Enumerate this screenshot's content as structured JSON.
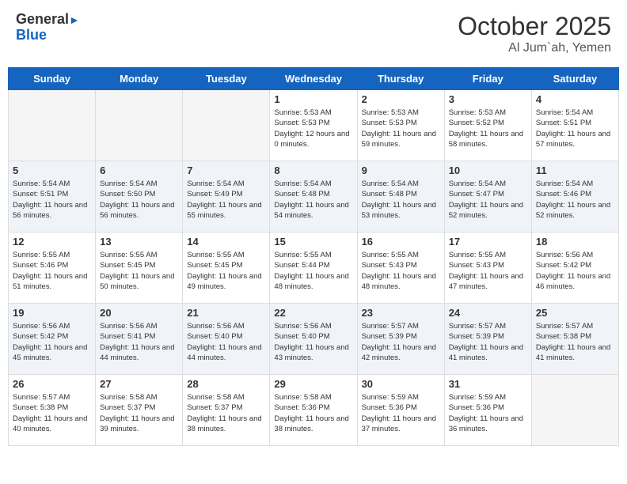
{
  "logo": {
    "line1": "General",
    "line2": "Blue"
  },
  "header": {
    "month": "October 2025",
    "location": "Al Jum`ah, Yemen"
  },
  "weekdays": [
    "Sunday",
    "Monday",
    "Tuesday",
    "Wednesday",
    "Thursday",
    "Friday",
    "Saturday"
  ],
  "weeks": [
    [
      {
        "day": "",
        "sunrise": "",
        "sunset": "",
        "daylight": ""
      },
      {
        "day": "",
        "sunrise": "",
        "sunset": "",
        "daylight": ""
      },
      {
        "day": "",
        "sunrise": "",
        "sunset": "",
        "daylight": ""
      },
      {
        "day": "1",
        "sunrise": "Sunrise: 5:53 AM",
        "sunset": "Sunset: 5:53 PM",
        "daylight": "Daylight: 12 hours and 0 minutes."
      },
      {
        "day": "2",
        "sunrise": "Sunrise: 5:53 AM",
        "sunset": "Sunset: 5:53 PM",
        "daylight": "Daylight: 11 hours and 59 minutes."
      },
      {
        "day": "3",
        "sunrise": "Sunrise: 5:53 AM",
        "sunset": "Sunset: 5:52 PM",
        "daylight": "Daylight: 11 hours and 58 minutes."
      },
      {
        "day": "4",
        "sunrise": "Sunrise: 5:54 AM",
        "sunset": "Sunset: 5:51 PM",
        "daylight": "Daylight: 11 hours and 57 minutes."
      }
    ],
    [
      {
        "day": "5",
        "sunrise": "Sunrise: 5:54 AM",
        "sunset": "Sunset: 5:51 PM",
        "daylight": "Daylight: 11 hours and 56 minutes."
      },
      {
        "day": "6",
        "sunrise": "Sunrise: 5:54 AM",
        "sunset": "Sunset: 5:50 PM",
        "daylight": "Daylight: 11 hours and 56 minutes."
      },
      {
        "day": "7",
        "sunrise": "Sunrise: 5:54 AM",
        "sunset": "Sunset: 5:49 PM",
        "daylight": "Daylight: 11 hours and 55 minutes."
      },
      {
        "day": "8",
        "sunrise": "Sunrise: 5:54 AM",
        "sunset": "Sunset: 5:48 PM",
        "daylight": "Daylight: 11 hours and 54 minutes."
      },
      {
        "day": "9",
        "sunrise": "Sunrise: 5:54 AM",
        "sunset": "Sunset: 5:48 PM",
        "daylight": "Daylight: 11 hours and 53 minutes."
      },
      {
        "day": "10",
        "sunrise": "Sunrise: 5:54 AM",
        "sunset": "Sunset: 5:47 PM",
        "daylight": "Daylight: 11 hours and 52 minutes."
      },
      {
        "day": "11",
        "sunrise": "Sunrise: 5:54 AM",
        "sunset": "Sunset: 5:46 PM",
        "daylight": "Daylight: 11 hours and 52 minutes."
      }
    ],
    [
      {
        "day": "12",
        "sunrise": "Sunrise: 5:55 AM",
        "sunset": "Sunset: 5:46 PM",
        "daylight": "Daylight: 11 hours and 51 minutes."
      },
      {
        "day": "13",
        "sunrise": "Sunrise: 5:55 AM",
        "sunset": "Sunset: 5:45 PM",
        "daylight": "Daylight: 11 hours and 50 minutes."
      },
      {
        "day": "14",
        "sunrise": "Sunrise: 5:55 AM",
        "sunset": "Sunset: 5:45 PM",
        "daylight": "Daylight: 11 hours and 49 minutes."
      },
      {
        "day": "15",
        "sunrise": "Sunrise: 5:55 AM",
        "sunset": "Sunset: 5:44 PM",
        "daylight": "Daylight: 11 hours and 48 minutes."
      },
      {
        "day": "16",
        "sunrise": "Sunrise: 5:55 AM",
        "sunset": "Sunset: 5:43 PM",
        "daylight": "Daylight: 11 hours and 48 minutes."
      },
      {
        "day": "17",
        "sunrise": "Sunrise: 5:55 AM",
        "sunset": "Sunset: 5:43 PM",
        "daylight": "Daylight: 11 hours and 47 minutes."
      },
      {
        "day": "18",
        "sunrise": "Sunrise: 5:56 AM",
        "sunset": "Sunset: 5:42 PM",
        "daylight": "Daylight: 11 hours and 46 minutes."
      }
    ],
    [
      {
        "day": "19",
        "sunrise": "Sunrise: 5:56 AM",
        "sunset": "Sunset: 5:42 PM",
        "daylight": "Daylight: 11 hours and 45 minutes."
      },
      {
        "day": "20",
        "sunrise": "Sunrise: 5:56 AM",
        "sunset": "Sunset: 5:41 PM",
        "daylight": "Daylight: 11 hours and 44 minutes."
      },
      {
        "day": "21",
        "sunrise": "Sunrise: 5:56 AM",
        "sunset": "Sunset: 5:40 PM",
        "daylight": "Daylight: 11 hours and 44 minutes."
      },
      {
        "day": "22",
        "sunrise": "Sunrise: 5:56 AM",
        "sunset": "Sunset: 5:40 PM",
        "daylight": "Daylight: 11 hours and 43 minutes."
      },
      {
        "day": "23",
        "sunrise": "Sunrise: 5:57 AM",
        "sunset": "Sunset: 5:39 PM",
        "daylight": "Daylight: 11 hours and 42 minutes."
      },
      {
        "day": "24",
        "sunrise": "Sunrise: 5:57 AM",
        "sunset": "Sunset: 5:39 PM",
        "daylight": "Daylight: 11 hours and 41 minutes."
      },
      {
        "day": "25",
        "sunrise": "Sunrise: 5:57 AM",
        "sunset": "Sunset: 5:38 PM",
        "daylight": "Daylight: 11 hours and 41 minutes."
      }
    ],
    [
      {
        "day": "26",
        "sunrise": "Sunrise: 5:57 AM",
        "sunset": "Sunset: 5:38 PM",
        "daylight": "Daylight: 11 hours and 40 minutes."
      },
      {
        "day": "27",
        "sunrise": "Sunrise: 5:58 AM",
        "sunset": "Sunset: 5:37 PM",
        "daylight": "Daylight: 11 hours and 39 minutes."
      },
      {
        "day": "28",
        "sunrise": "Sunrise: 5:58 AM",
        "sunset": "Sunset: 5:37 PM",
        "daylight": "Daylight: 11 hours and 38 minutes."
      },
      {
        "day": "29",
        "sunrise": "Sunrise: 5:58 AM",
        "sunset": "Sunset: 5:36 PM",
        "daylight": "Daylight: 11 hours and 38 minutes."
      },
      {
        "day": "30",
        "sunrise": "Sunrise: 5:59 AM",
        "sunset": "Sunset: 5:36 PM",
        "daylight": "Daylight: 11 hours and 37 minutes."
      },
      {
        "day": "31",
        "sunrise": "Sunrise: 5:59 AM",
        "sunset": "Sunset: 5:36 PM",
        "daylight": "Daylight: 11 hours and 36 minutes."
      },
      {
        "day": "",
        "sunrise": "",
        "sunset": "",
        "daylight": ""
      }
    ]
  ]
}
